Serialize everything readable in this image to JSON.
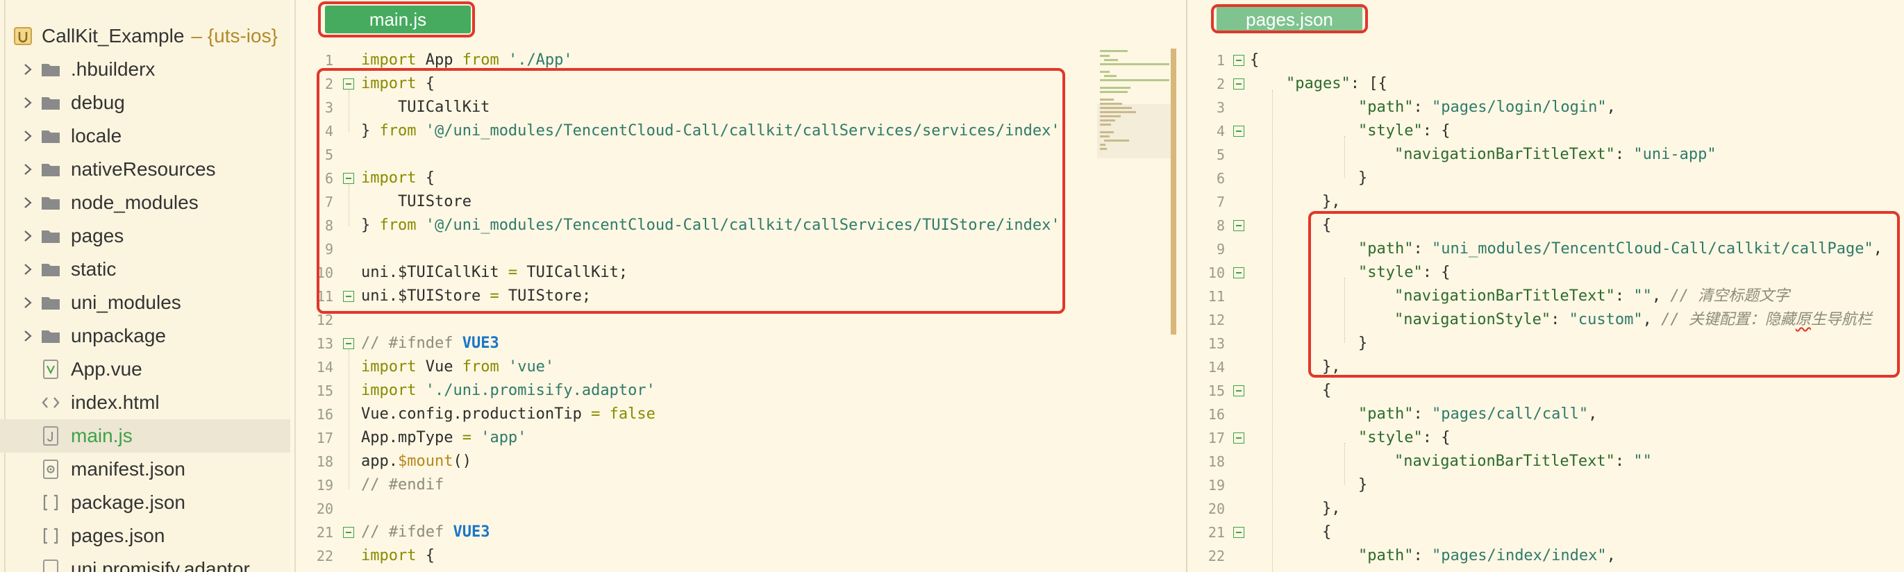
{
  "project": {
    "name": "CallKit_Example",
    "tag": "– {uts-ios}"
  },
  "sidebar": {
    "items": [
      {
        "label": ".hbuilderx",
        "type": "folder"
      },
      {
        "label": "debug",
        "type": "folder"
      },
      {
        "label": "locale",
        "type": "folder"
      },
      {
        "label": "nativeResources",
        "type": "folder"
      },
      {
        "label": "node_modules",
        "type": "folder"
      },
      {
        "label": "pages",
        "type": "folder"
      },
      {
        "label": "static",
        "type": "folder"
      },
      {
        "label": "uni_modules",
        "type": "folder"
      },
      {
        "label": "unpackage",
        "type": "folder"
      },
      {
        "label": "App.vue",
        "type": "vue"
      },
      {
        "label": "index.html",
        "type": "html"
      },
      {
        "label": "main.js",
        "type": "js",
        "active": true
      },
      {
        "label": "manifest.json",
        "type": "gear"
      },
      {
        "label": "package.json",
        "type": "json"
      },
      {
        "label": "pages.json",
        "type": "json"
      },
      {
        "label": "uni.promisify.adaptor",
        "type": "js"
      }
    ]
  },
  "editor_left": {
    "tab": "main.js",
    "line_numbers": [
      "1",
      "2",
      "3",
      "4",
      "5",
      "6",
      "7",
      "8",
      "9",
      "10",
      "11",
      "12",
      "13",
      "14",
      "15",
      "16",
      "17",
      "18",
      "19",
      "20",
      "21",
      "22"
    ],
    "lines": {
      "l1a": "import",
      "l1b": " App ",
      "l1c": "from",
      "l1d": " './App'",
      "l2a": "import",
      "l2b": " {",
      "l3": "    TUICallKit",
      "l4a": "} ",
      "l4b": "from",
      "l4c": " '@/uni_modules/TencentCloud-Call/callkit/callServices/services/index'",
      "l6a": "import",
      "l6b": " {",
      "l7": "    TUIStore",
      "l8a": "} ",
      "l8b": "from",
      "l8c": " '@/uni_modules/TencentCloud-Call/callkit/callServices/TUIStore/index'",
      "l10a": "uni.$TUICallKit ",
      "l10b": "=",
      "l10c": " TUICallKit;",
      "l11a": "uni.$TUIStore ",
      "l11b": "=",
      "l11c": " TUIStore;",
      "l13a": "// #ifndef ",
      "l13b": "VUE3",
      "l14a": "import",
      "l14b": " Vue ",
      "l14c": "from",
      "l14d": " 'vue'",
      "l15a": "import",
      "l15b": " './uni.promisify.adaptor'",
      "l16a": "Vue.config.productionTip ",
      "l16b": "=",
      "l16c": " ",
      "l16d": "false",
      "l17a": "App.mpType ",
      "l17b": "=",
      "l17c": " 'app'",
      "l18a": "app.",
      "l18b": "$mount",
      "l18c": "()",
      "l19": "// #endif",
      "l21a": "// #ifdef ",
      "l21b": "VUE3",
      "l22a": "import",
      "l22b": " {"
    }
  },
  "editor_right": {
    "tab": "pages.json",
    "line_numbers": [
      "1",
      "2",
      "3",
      "4",
      "5",
      "6",
      "7",
      "8",
      "9",
      "10",
      "11",
      "12",
      "13",
      "14",
      "15",
      "16",
      "17",
      "18",
      "19",
      "20",
      "21",
      "22"
    ],
    "lines": {
      "l1": "{",
      "l2a": "\"pages\"",
      "l2b": ": [{",
      "l3a": "\"path\"",
      "l3b": ": ",
      "l3c": "\"pages/login/login\"",
      "l3d": ",",
      "l4a": "\"style\"",
      "l4b": ": {",
      "l5a": "\"navigationBarTitleText\"",
      "l5b": ": ",
      "l5c": "\"uni-app\"",
      "l6": "}",
      "l7": "},",
      "l8": "{",
      "l9a": "\"path\"",
      "l9b": ": ",
      "l9c": "\"uni_modules/TencentCloud-Call/callkit/callPage\"",
      "l9d": ",",
      "l10a": "\"style\"",
      "l10b": ": {",
      "l11a": "\"navigationBarTitleText\"",
      "l11b": ": ",
      "l11c": "\"\"",
      "l11d": ", ",
      "l11e": "// 清空标题文字",
      "l12a": "\"navigationStyle\"",
      "l12b": ": ",
      "l12c": "\"custom\"",
      "l12d": ", ",
      "l12e1": "// 关键配置：隐藏",
      "l12e2": "原",
      "l12e3": "生导航栏",
      "l13": "}",
      "l14": "},",
      "l15": "{",
      "l16a": "\"path\"",
      "l16b": ": ",
      "l16c": "\"pages/call/call\"",
      "l16d": ",",
      "l17a": "\"style\"",
      "l17b": ": {",
      "l18a": "\"navigationBarTitleText\"",
      "l18b": ": ",
      "l18c": "\"\"",
      "l19": "}",
      "l20": "},",
      "l21": "{",
      "l22a": "\"path\"",
      "l22b": ": ",
      "l22c": "\"pages/index/index\"",
      "l22d": ","
    }
  },
  "colors": {
    "accent_green": "#46ab5e",
    "highlight_red": "#e1372b",
    "background": "#fdf7e3"
  }
}
